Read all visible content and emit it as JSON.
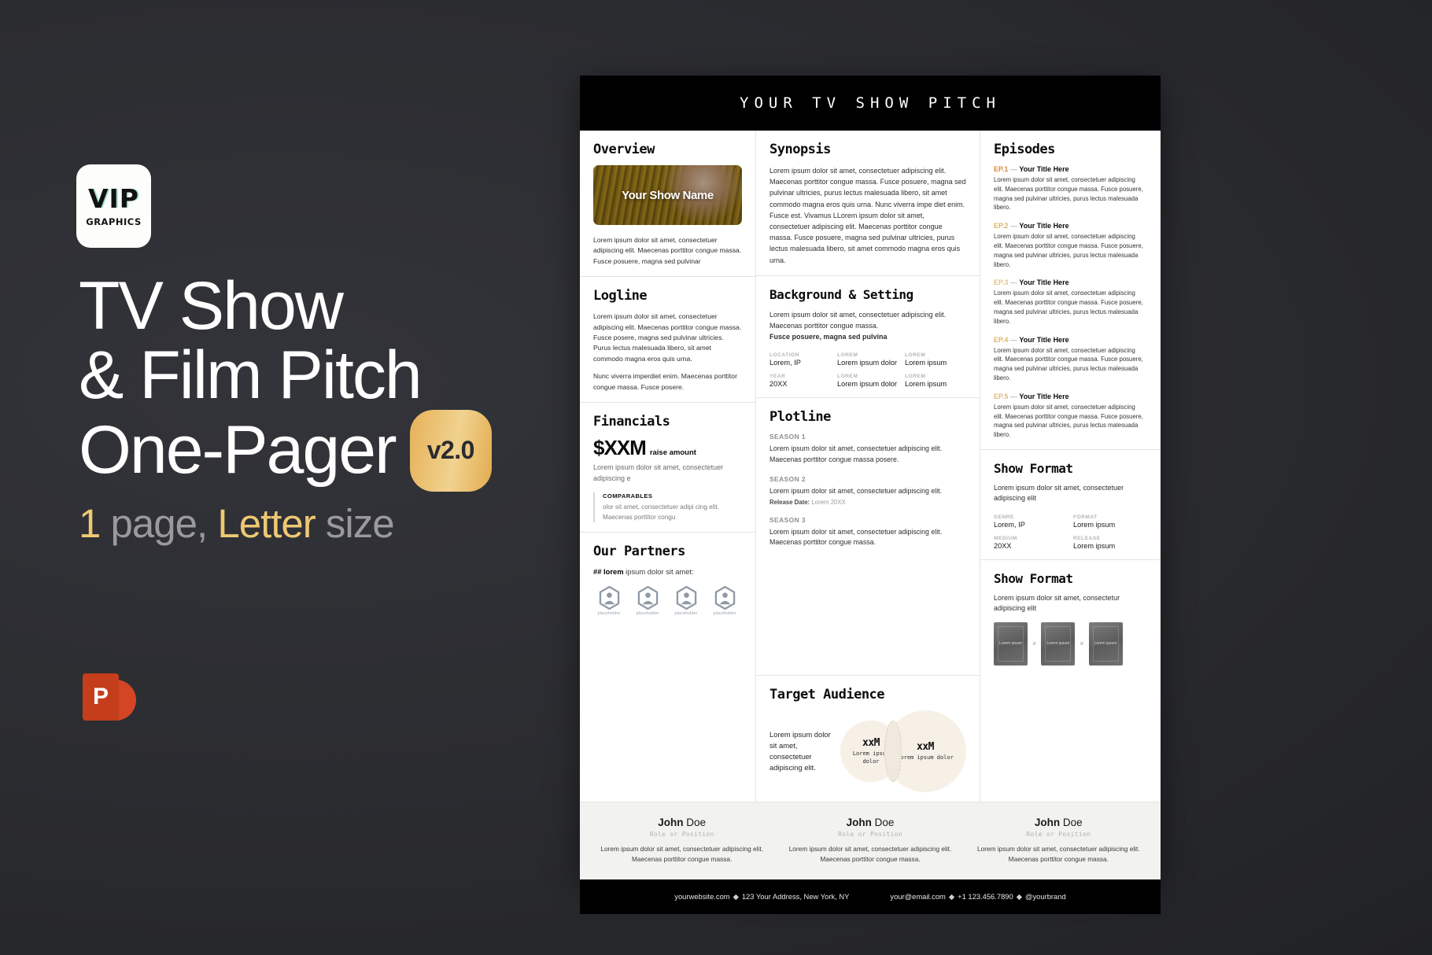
{
  "promo": {
    "logo": {
      "vip": "VIP",
      "graphics": "GRAPHICS"
    },
    "title_line1": "TV Show",
    "title_line2": "& Film Pitch",
    "title_line3": "One-Pager",
    "version_badge": "v2.0",
    "sub_count": "1",
    "sub_page": " page, ",
    "sub_letter": "Letter",
    "sub_size": " size",
    "ppt_letter": "P"
  },
  "document": {
    "header_title": "YOUR TV SHOW PITCH",
    "overview": {
      "heading": "Overview",
      "image_label": "Your Show Name",
      "body": "Lorem ipsum dolor sit amet, consectetuer adipiscing elit. Maecenas porttitor congue massa. Fusce posuere, magna sed pulvinar"
    },
    "logline": {
      "heading": "Logline",
      "p1": "Lorem ipsum dolor sit amet, consectetuer adipiscing elit. Maecenas porttitor congue massa. Fusce posere, magna sed pulvinar ultricies. Purus lectus malesuada libero, sit amet commodo magna eros quis urna.",
      "p2": "Nunc viverra imperdiet enim. Maecenas porttitor congue massa. Fusce posere."
    },
    "financials": {
      "heading": "Financials",
      "amount": "$XXM",
      "amount_note": "raise amount",
      "desc": "Lorem ipsum dolor sit amet, consectetuer adipiscing e",
      "comparables_label": "COMPARABLES",
      "comparables_text": "olor sit amet, consectetuer adipi cing elit. Maecenas porttitor congu"
    },
    "partners": {
      "heading": "Our Partners",
      "line_bold": "## lorem",
      "line_rest": " ipsum dolor sit amet:",
      "items": [
        {
          "caption": "placeholder"
        },
        {
          "caption": "placeholder"
        },
        {
          "caption": "placeholder"
        },
        {
          "caption": "placeholder"
        }
      ]
    },
    "synopsis": {
      "heading": "Synopsis",
      "body": "Lorem ipsum dolor sit amet, consectetuer adipiscing elit. Maecenas porttitor congue massa. Fusce posuere, magna sed pulvinar ultricies, purus lectus malesuada libero, sit amet commodo magna eros quis urna. Nunc viverra impe diet enim. Fusce est. Vivamus LLorem ipsum dolor sit amet, consectetuer adipiscing elit. Maecenas porttitor congue massa. Fusce posuere, magna sed pulvinar ultricies, purus lectus malesuada libero, sit amet commodo magna eros quis urna."
    },
    "background": {
      "heading": "Background & Setting",
      "body": "Lorem ipsum dolor sit amet, consectetuer adipiscing elit. Maecenas porttitor congue massa.",
      "body_bold": "Fusce posuere, magna sed pulvina",
      "meta": [
        {
          "key": "LOCATION",
          "val": "Lorem, IP"
        },
        {
          "key": "LOREM",
          "val": "Lorem ipsum dolor"
        },
        {
          "key": "LOREM",
          "val": "Lorem ipsum"
        },
        {
          "key": "YEAR",
          "val": "20XX"
        },
        {
          "key": "LOREM",
          "val": "Lorem ipsum dolor"
        },
        {
          "key": "LOREM",
          "val": "Lorem ipsum"
        }
      ]
    },
    "plotline": {
      "heading": "Plotline",
      "seasons": [
        {
          "label": "SEASON 1",
          "text": "Lorem ipsum dolor sit amet, consectetuer adipiscing elit. Maecenas porttitor congue massa posere.",
          "release_label": "",
          "release_value": ""
        },
        {
          "label": "SEASON 2",
          "text": "Lorem ipsum dolor sit amet, consectetuer adipiscing elit.",
          "release_label": "Release Date:",
          "release_value": " Lorem 20XX"
        },
        {
          "label": "SEASON 3",
          "text": "Lorem ipsum dolor sit amet, consectetuer adipiscing elit. Maecenas porttitor congue massa.",
          "release_label": "",
          "release_value": ""
        }
      ]
    },
    "target_audience": {
      "heading": "Target Audience",
      "text": "Lorem ipsum dolor sit amet, consectetuer adipiscing elit.",
      "circle_left": {
        "value": "xxM",
        "label": "Lorem ipsum dolor"
      },
      "circle_right": {
        "value": "xxM",
        "label": "Lorem ipsum dolor"
      }
    },
    "episodes": {
      "heading": "Episodes",
      "items": [
        {
          "no": "EP.1",
          "dash": "—",
          "title": "Your Title Here",
          "color": "#d98b3f",
          "text": "Lorem ipsum dolor sit amet, consectetuer adipiscing elit. Maecenas porttitor congue massa. Fusce posuere, magna sed pulvinar ultricies, purus lectus malesuada libero."
        },
        {
          "no": "EP.2",
          "dash": "—",
          "title": "Your Title Here",
          "color": "#ddb367",
          "text": "Lorem ipsum dolor sit amet, consectetuer adipiscing elit. Maecenas porttitor congue massa. Fusce posuere, magna sed pulvinar ultricies, purus lectus malesuada libero."
        },
        {
          "no": "EP.3",
          "dash": "—",
          "title": "Your Title Here",
          "color": "#e0c48d",
          "text": "Lorem ipsum dolor sit amet, consectetuer adipiscing elit. Maecenas porttitor congue massa. Fusce posuere, magna sed pulvinar ultricies, purus lectus malesuada libero."
        },
        {
          "no": "EP.4",
          "dash": "—",
          "title": "Your Title Here",
          "color": "#dcb76e",
          "text": "Lorem ipsum dolor sit amet, consectetuer adipiscing elit. Maecenas porttitor congue massa. Fusce posuere, magna sed pulvinar ultricies, purus lectus malesuada libero."
        },
        {
          "no": "EP.5",
          "dash": "—",
          "title": "Your Title Here",
          "color": "#ddb97b",
          "text": "Lorem ipsum dolor sit amet, consectetuer adipiscing elit. Maecenas porttitor congue massa. Fusce posuere, magna sed pulvinar ultricies, purus lectus malesuada libero."
        }
      ]
    },
    "show_format_1": {
      "heading": "Show Format",
      "body": "Lorem ipsum dolor sit amet, consectetuer adipiscing elit",
      "meta": [
        {
          "key": "GENRE",
          "val": "Lorem, IP"
        },
        {
          "key": "FORMAT",
          "val": "Lorem ipsum"
        },
        {
          "key": "MEDIUM",
          "val": "20XX"
        },
        {
          "key": "RELEASE",
          "val": "Lorem ipsum"
        }
      ]
    },
    "show_format_2": {
      "heading": "Show Format",
      "body": "Lorem ipsum dolor sit amet, consectetur adipiscing elit",
      "posters": [
        {
          "mark": "Lorem ipsum"
        },
        {
          "mark": "Lorem ipsum"
        },
        {
          "mark": "Lorem ipsum"
        }
      ],
      "separator": "×"
    },
    "team": [
      {
        "first": "John",
        "last": " Doe",
        "role": "Role or Position",
        "bio": "Lorem ipsum dolor sit amet, consectetuer adipiscing elit. Maecenas porttitor congue massa."
      },
      {
        "first": "John",
        "last": " Doe",
        "role": "Role or Position",
        "bio": "Lorem ipsum dolor sit amet, consectetuer adipiscing elit. Maecenas porttitor congue massa."
      },
      {
        "first": "John",
        "last": " Doe",
        "role": "Role or Position",
        "bio": "Lorem ipsum dolor sit amet, consectetuer adipiscing elit. Maecenas porttitor congue massa."
      }
    ],
    "contact": {
      "left_website": "yourwebsite.com",
      "left_sep": "◆",
      "left_address": "123 Your Address, New York, NY",
      "right_email": "your@email.com",
      "right_sep1": "◆",
      "right_phone": "+1 123.456.7890",
      "right_sep2": "◆",
      "right_handle": "@yourbrand"
    }
  }
}
